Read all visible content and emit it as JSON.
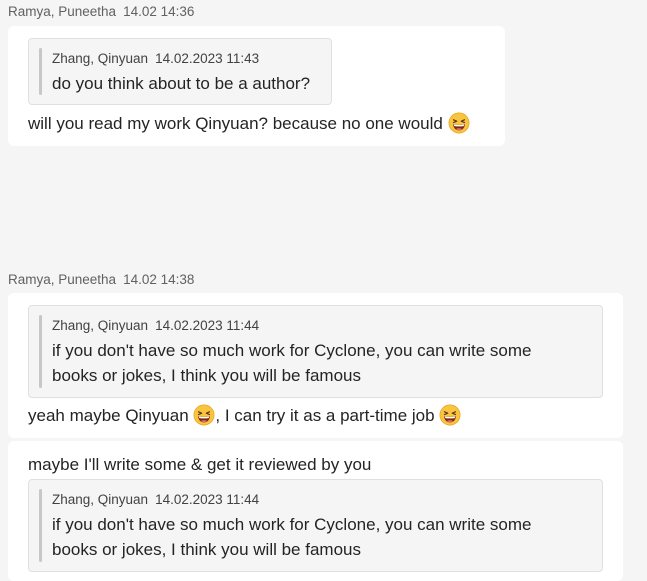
{
  "messages": [
    {
      "author": "Ramya, Puneetha",
      "time": "14.02 14:36",
      "quote": {
        "author": "Zhang, Qinyuan",
        "time": "14.02.2023 11:43",
        "lines": [
          "do you think about to be a author?"
        ]
      },
      "text": "will you read my work Qinyuan? because no one would",
      "emoji": "grinning-squint-emoji"
    },
    {
      "author": "Ramya, Puneetha",
      "time": "14.02 14:38",
      "quote": {
        "author": "Zhang, Qinyuan",
        "time": "14.02.2023 11:44",
        "lines": [
          "if you don't have so much work for Cyclone, you can write some",
          "books or jokes, I think you will be famous"
        ]
      },
      "text_parts": [
        "yeah maybe Qinyuan ",
        ", I can try it as a part-time job "
      ],
      "emoji": "grinning-squint-emoji"
    },
    {
      "text": "maybe I'll write some & get it reviewed by you",
      "quote": {
        "author": "Zhang, Qinyuan",
        "time": "14.02.2023 11:44",
        "lines": [
          "if you don't have so much work for Cyclone, you can write some",
          "books or jokes, I think you will be famous"
        ]
      }
    }
  ]
}
